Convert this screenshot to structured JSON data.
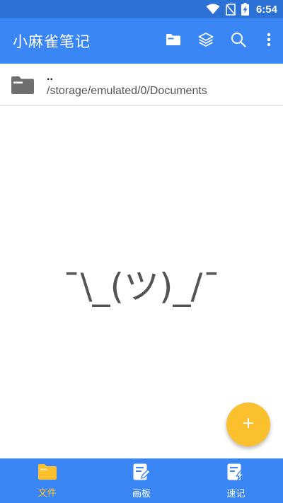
{
  "status_bar": {
    "time": "6:54",
    "icons": [
      "wifi-icon",
      "no-sim-icon",
      "battery-charging-icon"
    ]
  },
  "app_bar": {
    "title": "小麻雀笔记",
    "actions": [
      "folder-icon",
      "layers-icon",
      "search-icon",
      "more-vert-icon"
    ]
  },
  "path_row": {
    "parent": "..",
    "current_path": "/storage/emulated/0/Documents"
  },
  "empty_state": {
    "text": "¯\\_(ツ)_/¯"
  },
  "fab": {
    "icon": "plus-icon"
  },
  "bottom_nav": {
    "items": [
      {
        "label": "文件",
        "icon": "folder-icon",
        "active": true
      },
      {
        "label": "画板",
        "icon": "drawing-board-icon",
        "active": false
      },
      {
        "label": "速记",
        "icon": "quick-note-icon",
        "active": false
      }
    ]
  },
  "colors": {
    "status_bar": "#2c72d6",
    "primary": "#3a86f4",
    "accent": "#fbc02d",
    "folder_gray": "#6f6f6f"
  }
}
